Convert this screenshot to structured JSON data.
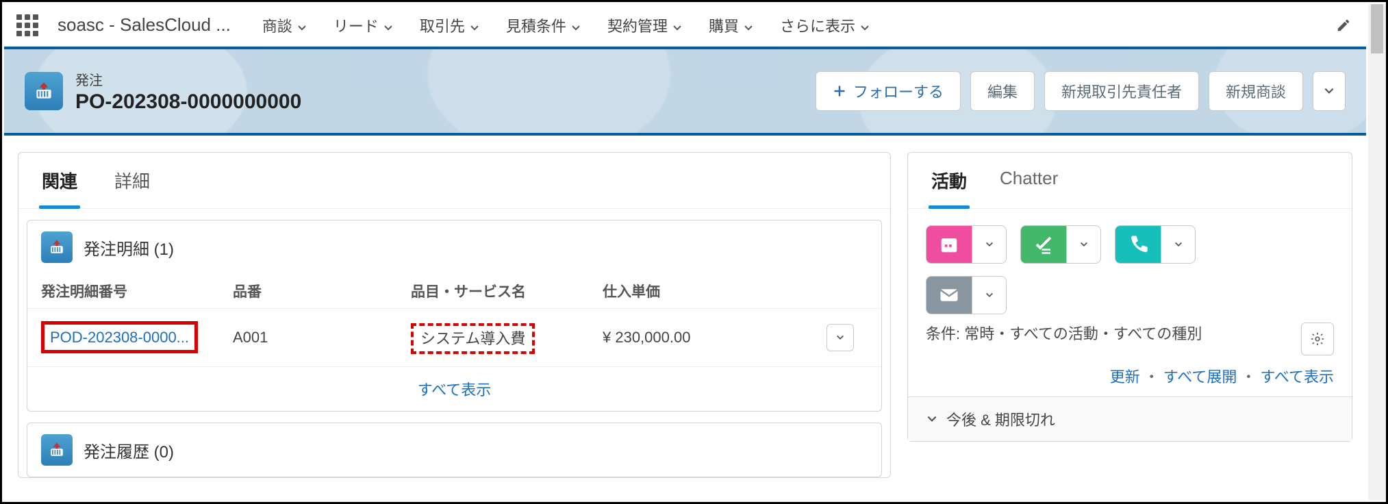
{
  "nav": {
    "app_name": "soasc - SalesCloud ...",
    "tabs": [
      "商談",
      "リード",
      "取引先",
      "見積条件",
      "契約管理",
      "購買"
    ],
    "more_label": "さらに表示"
  },
  "record": {
    "object_label": "発注",
    "name": "PO-202308-0000000000",
    "follow_label": "フォローする",
    "actions": [
      "編集",
      "新規取引先責任者",
      "新規商談"
    ]
  },
  "left_tabs": {
    "related": "関連",
    "detail": "詳細"
  },
  "related": {
    "lists": [
      {
        "title": "発注明細",
        "count_label": "(1)",
        "columns": [
          "発注明細番号",
          "品番",
          "品目・サービス名",
          "仕入単価"
        ],
        "rows": [
          {
            "num": "POD-202308-0000...",
            "code": "A001",
            "item": "システム導入費",
            "price": "¥ 230,000.00"
          }
        ],
        "view_all": "すべて表示"
      },
      {
        "title": "発注履歴",
        "count_label": "(0)"
      }
    ]
  },
  "right": {
    "tabs": {
      "activity": "活動",
      "chatter": "Chatter"
    },
    "filter_prefix": "条件:",
    "filter_text": "常時・すべての活動・すべての種別",
    "links": [
      "更新",
      "すべて展開",
      "すべて表示"
    ],
    "collapse_label": "今後 & 期限切れ"
  }
}
